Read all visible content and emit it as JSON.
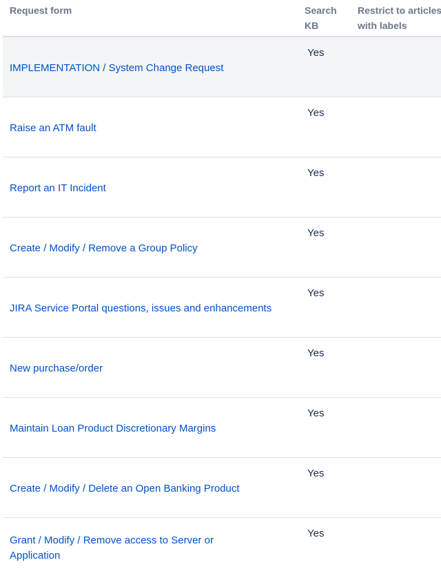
{
  "headers": {
    "form": "Request form",
    "kb": "Search KB",
    "restrict": "Restrict to articles with labels"
  },
  "rows": [
    {
      "form": "IMPLEMENTATION / System Change Request",
      "kb": "Yes",
      "restrict": ""
    },
    {
      "form": "Raise an ATM fault",
      "kb": "Yes",
      "restrict": ""
    },
    {
      "form": "Report an IT Incident",
      "kb": "Yes",
      "restrict": ""
    },
    {
      "form": "Create / Modify / Remove a Group Policy",
      "kb": "Yes",
      "restrict": ""
    },
    {
      "form": "JIRA Service Portal questions, issues and enhancements",
      "kb": "Yes",
      "restrict": ""
    },
    {
      "form": "New purchase/order",
      "kb": "Yes",
      "restrict": ""
    },
    {
      "form": "Maintain Loan Product Discretionary Margins",
      "kb": "Yes",
      "restrict": ""
    },
    {
      "form": "Create / Modify / Delete an Open Banking Product",
      "kb": "Yes",
      "restrict": ""
    },
    {
      "form": "Grant / Modify / Remove access to Server or Application",
      "kb": "Yes",
      "restrict": ""
    }
  ]
}
